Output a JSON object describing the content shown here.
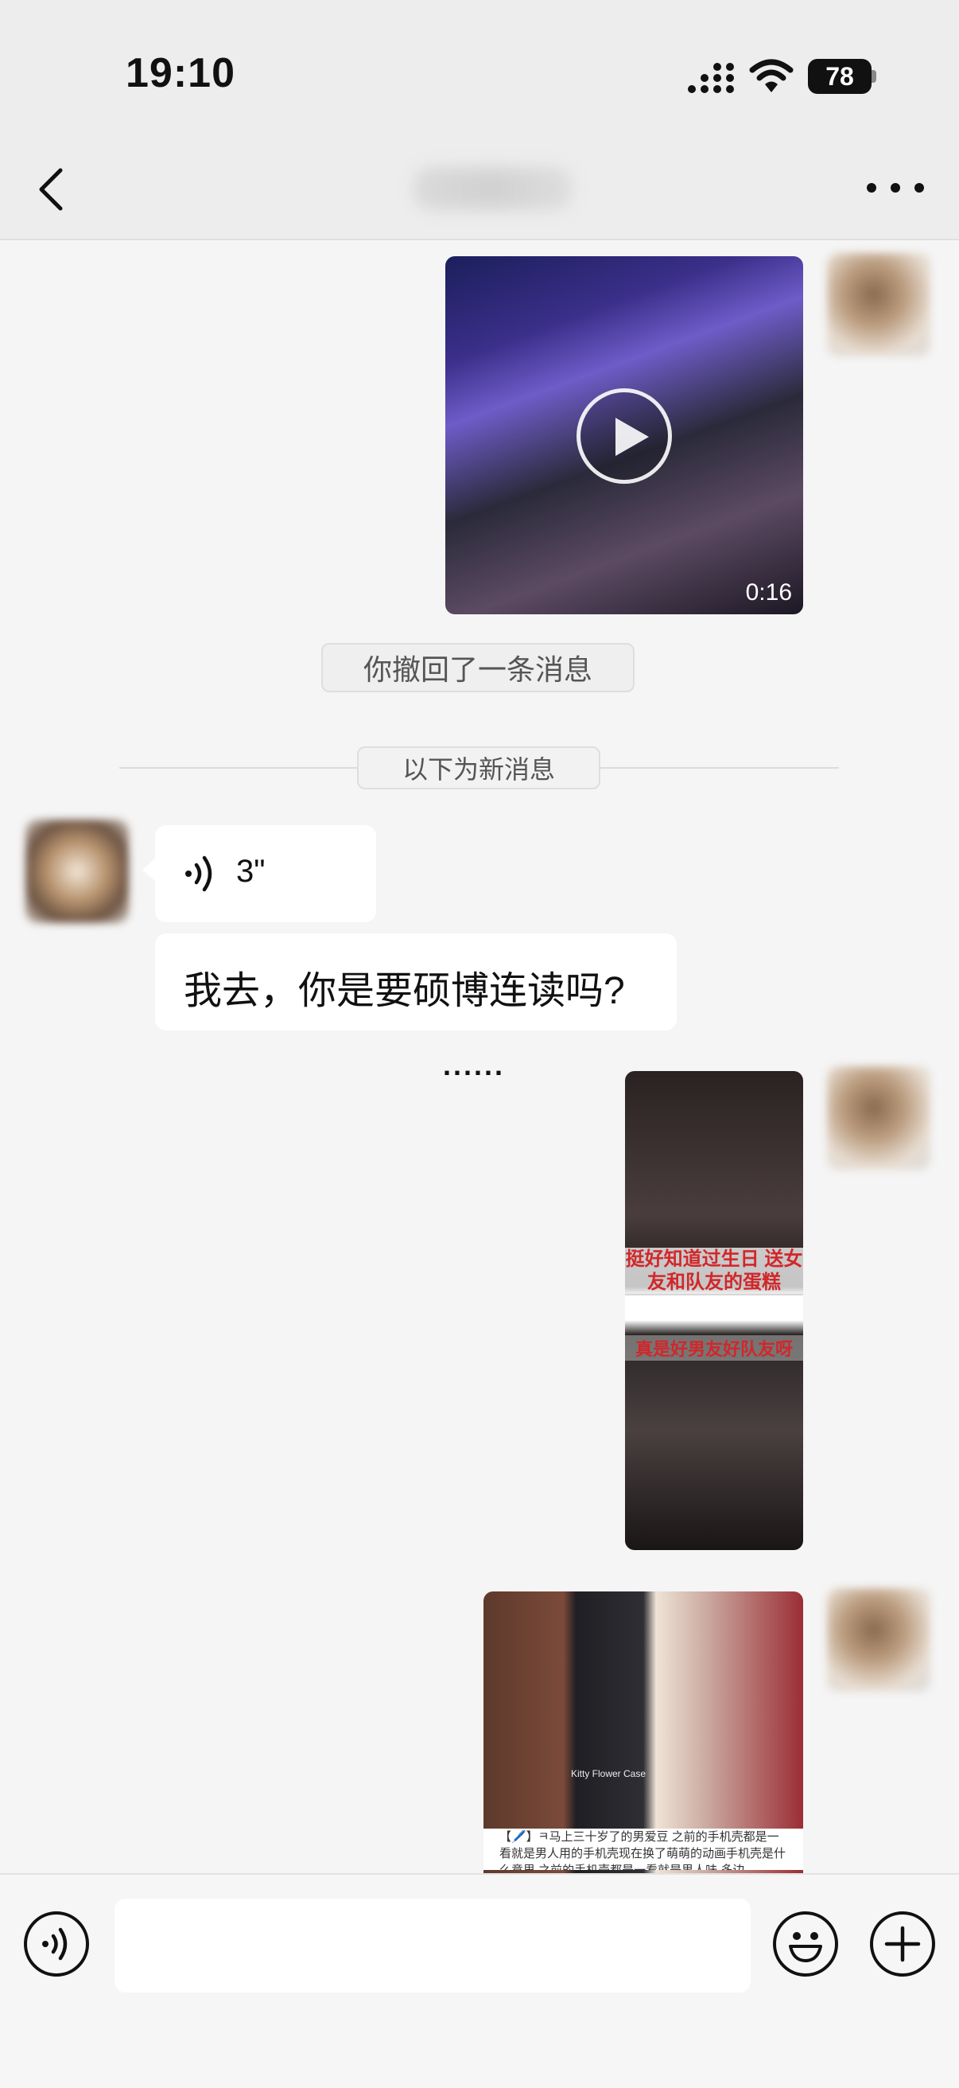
{
  "status_bar": {
    "time": "19:10",
    "battery": "78",
    "signal_icon": "cellular-signal-icon",
    "wifi_icon": "wifi-icon"
  },
  "nav": {
    "back_icon": "chevron-left-icon",
    "title": "",
    "more_icon": "more-dots-icon"
  },
  "messages": {
    "video": {
      "duration": "0:16",
      "play_icon": "play-icon"
    },
    "recall_notice": "你撤回了一条消息",
    "new_messages_divider": "以下为新消息",
    "voice": {
      "duration": "3\"",
      "icon": "voice-wave-icon"
    },
    "text": "我去，你是要硕博连读吗?",
    "typing": "......",
    "image1": {
      "caption_top": "挺好知道过生日 送女友和队友的蛋糕",
      "caption_bottom": "真是好男友好队友呀"
    },
    "image2": {
      "caption": "【🖊️】ㅋ马上三十岁了的男爱豆 之前的手机壳都是一看就是男人用的手机壳现在换了萌萌的动画手机壳是什么意思 之前的手机壳都是一看就是男人味 多边",
      "case_label": "Kitty Flower Case"
    }
  },
  "input_bar": {
    "voice_icon": "voice-input-icon",
    "placeholder": "",
    "emoji_icon": "emoji-icon",
    "plus_icon": "plus-icon"
  }
}
